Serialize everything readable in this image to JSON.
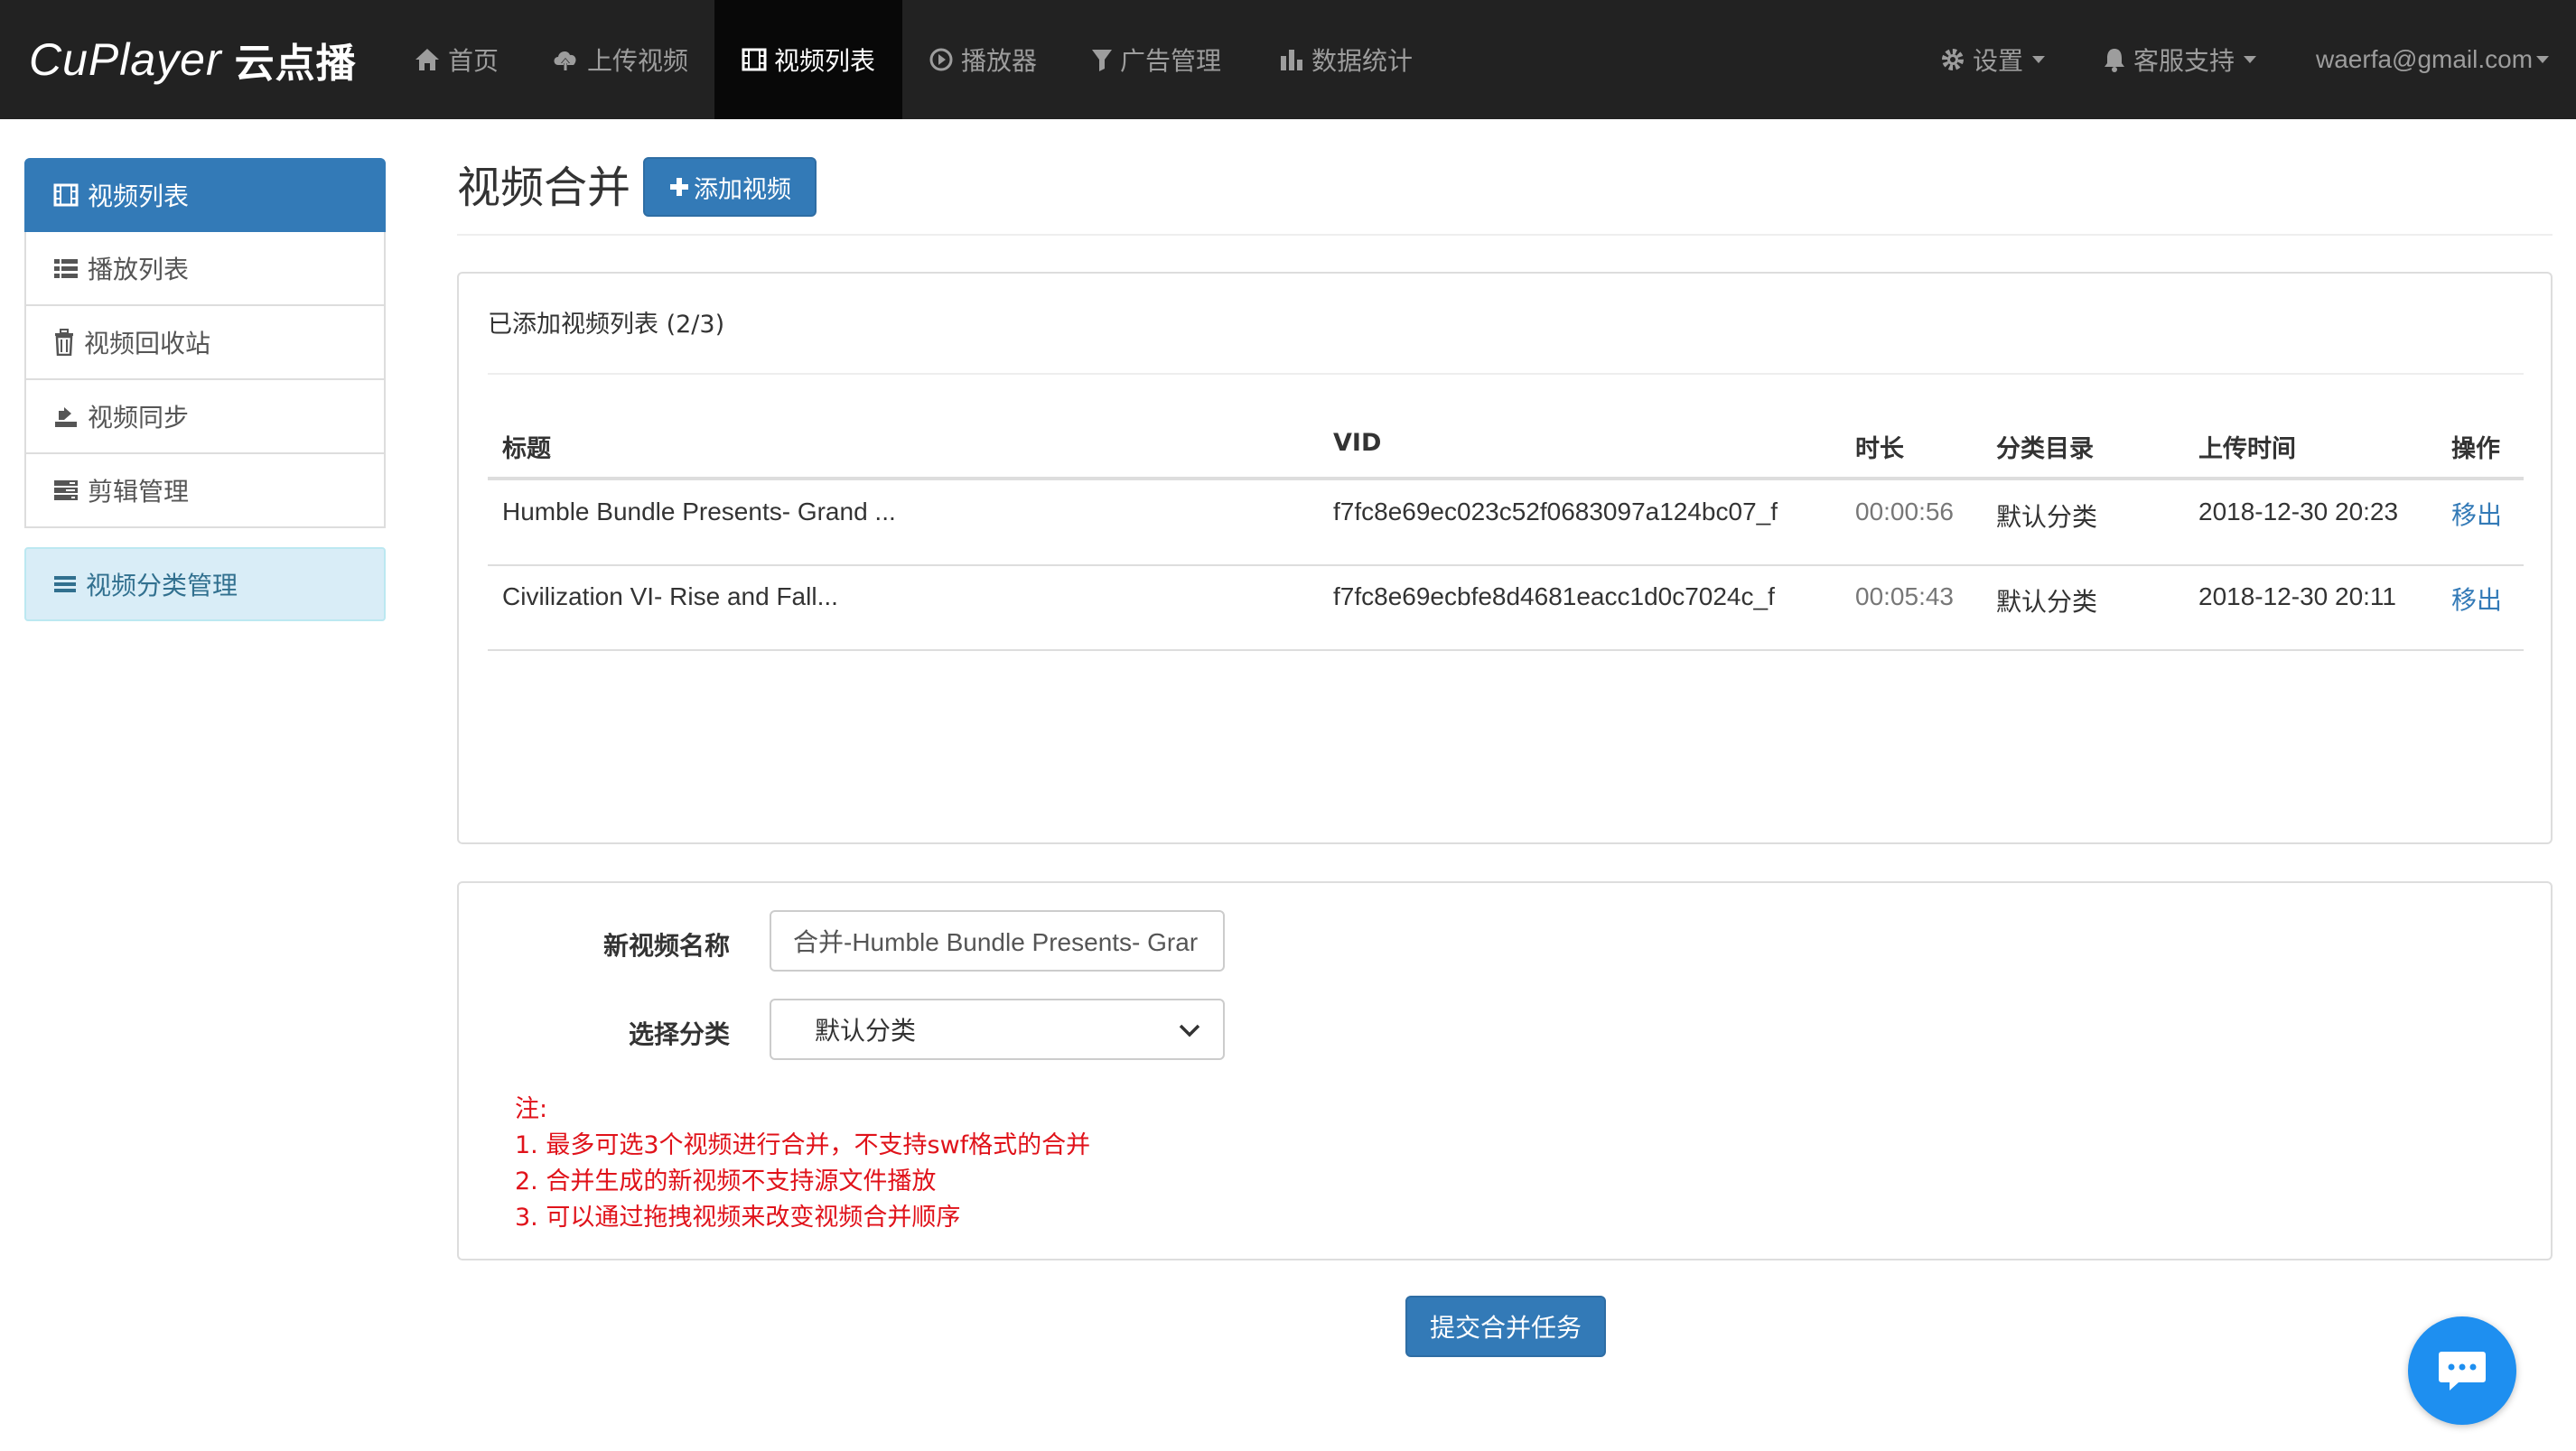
{
  "brand": {
    "latin": "CuPlayer",
    "cn": "云点播"
  },
  "nav": {
    "items": [
      {
        "label": "首页",
        "icon": "home-icon"
      },
      {
        "label": "上传视频",
        "icon": "cloud-upload-icon"
      },
      {
        "label": "视频列表",
        "icon": "film-icon",
        "active": true
      },
      {
        "label": "播放器",
        "icon": "play-circle-icon"
      },
      {
        "label": "广告管理",
        "icon": "filter-icon"
      },
      {
        "label": "数据统计",
        "icon": "bar-chart-icon"
      }
    ],
    "settings_label": "设置",
    "support_label": "客服支持",
    "user_email": "waerfa@gmail.com"
  },
  "sidebar": {
    "items": [
      {
        "label": "视频列表",
        "icon": "film-icon",
        "active": true
      },
      {
        "label": "播放列表",
        "icon": "list-icon"
      },
      {
        "label": "视频回收站",
        "icon": "trash-icon"
      },
      {
        "label": "视频同步",
        "icon": "sync-icon"
      },
      {
        "label": "剪辑管理",
        "icon": "tasks-icon"
      }
    ],
    "category_label": "视频分类管理"
  },
  "page": {
    "title": "视频合并",
    "add_button_label": "添加视频"
  },
  "video_list": {
    "heading": "已添加视频列表 (2/3)",
    "columns": [
      "标题",
      "VID",
      "时长",
      "分类目录",
      "上传时间",
      "操作"
    ],
    "rows": [
      {
        "title": "Humble Bundle Presents- Grand ...",
        "vid": "f7fc8e69ec023c52f0683097a124bc07_f",
        "duration": "00:00:56",
        "category": "默认分类",
        "upload_time": "2018-12-30 20:23",
        "action": "移出"
      },
      {
        "title": "Civilization VI- Rise and Fall...",
        "vid": "f7fc8e69ecbfe8d4681eacc1d0c7024c_f",
        "duration": "00:05:43",
        "category": "默认分类",
        "upload_time": "2018-12-30 20:11",
        "action": "移出"
      }
    ]
  },
  "form": {
    "name_label": "新视频名称",
    "name_value": "合并-Humble Bundle Presents- Grar",
    "category_label": "选择分类",
    "category_value": "默认分类",
    "notes": [
      "注:",
      "1. 最多可选3个视频进行合并，不支持swf格式的合并",
      "2. 合并生成的新视频不支持源文件播放",
      "3. 可以通过拖拽视频来改变视频合并顺序"
    ]
  },
  "submit_label": "提交合并任务",
  "colors": {
    "navbar": "#222222",
    "primary": "#337ab7",
    "note_red": "#e0121a",
    "chat": "#1e8ff0"
  }
}
